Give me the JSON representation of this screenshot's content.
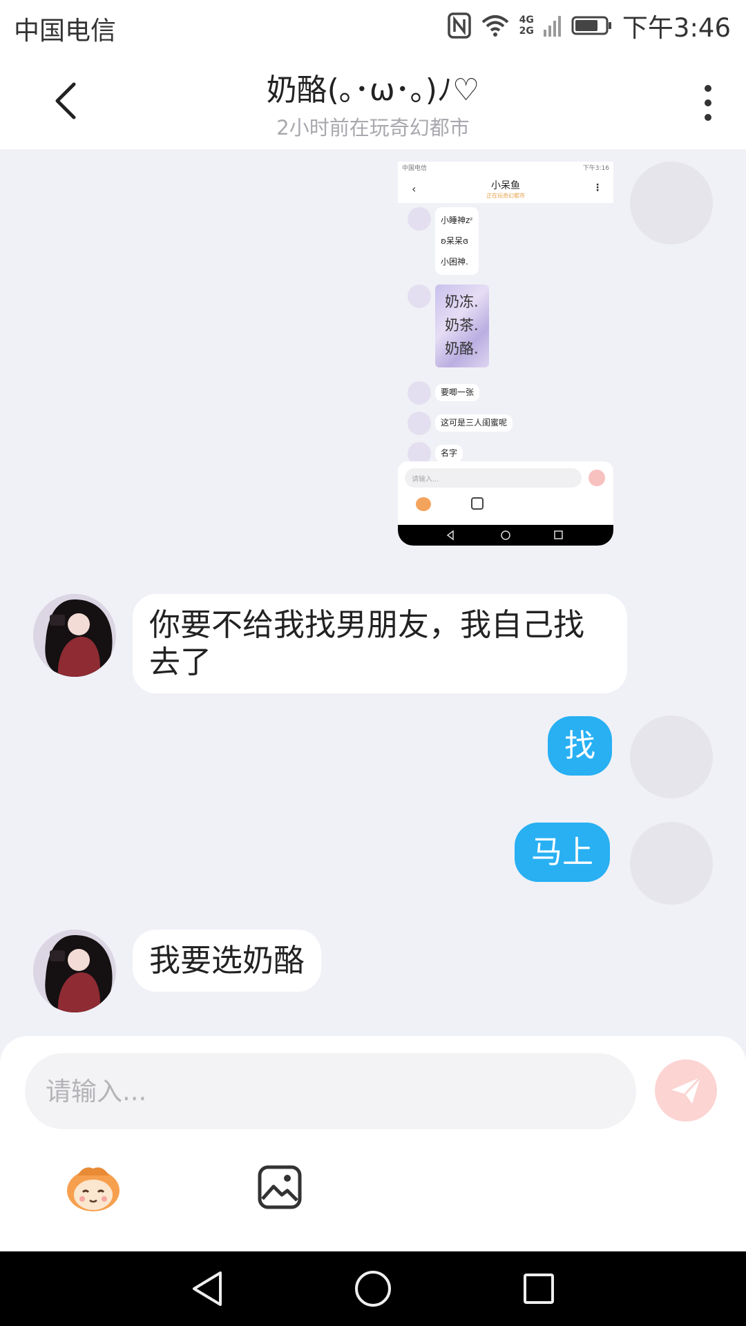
{
  "status_bar": {
    "carrier": "中国电信",
    "network_top": "4G",
    "network_bottom": "2G",
    "time": "下午3:46"
  },
  "header": {
    "title": "奶酪(｡･ω･｡)ﾉ♡",
    "subtitle": "2小时前在玩奇幻都市"
  },
  "messages": [
    {
      "side": "right",
      "type": "image"
    },
    {
      "side": "left",
      "text": "你要不给我找男朋友，我自己找去了"
    },
    {
      "side": "right",
      "text": "找"
    },
    {
      "side": "right",
      "text": "马上"
    },
    {
      "side": "left",
      "text": "我要选奶酪"
    }
  ],
  "shared_screenshot": {
    "status_carrier": "中国电信",
    "status_time": "下午3:16",
    "title": "小呆鱼",
    "subtitle": "正在玩奇幻都市",
    "bubble1_lines": [
      "小睡神zᶻ",
      "ʚ呆呆ɞ",
      "小困神."
    ],
    "image_lines": [
      "奶冻.",
      "奶茶.",
      "奶酪."
    ],
    "msg_a": "要唧一张",
    "msg_b": "这可是三人闺蜜呢",
    "msg_c": "名字",
    "input_placeholder": "请输入..."
  },
  "input": {
    "placeholder": "请输入..."
  },
  "colors": {
    "accent_blue": "#28b0f3",
    "send_button": "#fcd4d2",
    "background": "#f0f1f6"
  },
  "icons": {
    "back": "chevron-left-icon",
    "more": "more-vertical-icon",
    "send": "send-icon",
    "emoji": "emoji-face-icon",
    "image": "image-icon"
  }
}
